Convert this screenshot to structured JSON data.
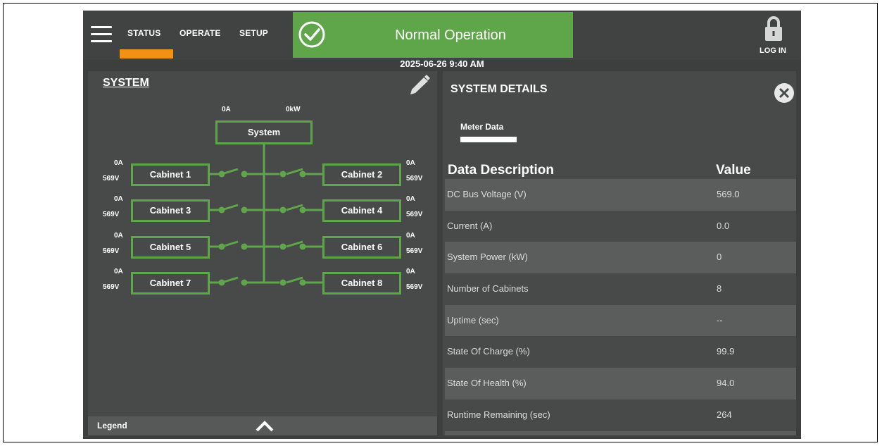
{
  "nav": {
    "items": [
      {
        "label": "STATUS",
        "active": true
      },
      {
        "label": "OPERATE",
        "active": false
      },
      {
        "label": "SETUP",
        "active": false
      }
    ]
  },
  "status": {
    "text": "Normal Operation",
    "color": "#5fa64a",
    "icon": "check-circle-icon"
  },
  "login": {
    "label": "LOG IN",
    "icon": "lock-icon"
  },
  "timestamp": "2025-06-26 9:40 AM",
  "system_panel": {
    "title": "SYSTEM",
    "edit_icon": "pencil-icon",
    "system_node": {
      "label": "System",
      "current": "0A",
      "power": "0kW"
    },
    "cabinets": [
      {
        "label": "Cabinet 1",
        "current": "0A",
        "voltage": "569V"
      },
      {
        "label": "Cabinet 2",
        "current": "0A",
        "voltage": "569V"
      },
      {
        "label": "Cabinet 3",
        "current": "0A",
        "voltage": "569V"
      },
      {
        "label": "Cabinet 4",
        "current": "0A",
        "voltage": "569V"
      },
      {
        "label": "Cabinet 5",
        "current": "0A",
        "voltage": "569V"
      },
      {
        "label": "Cabinet 6",
        "current": "0A",
        "voltage": "569V"
      },
      {
        "label": "Cabinet 7",
        "current": "0A",
        "voltage": "569V"
      },
      {
        "label": "Cabinet 8",
        "current": "0A",
        "voltage": "569V"
      }
    ],
    "legend_label": "Legend"
  },
  "details": {
    "title": "SYSTEM DETAILS",
    "tab": "Meter Data",
    "header_desc": "Data Description",
    "header_value": "Value",
    "rows": [
      {
        "desc": "DC Bus Voltage (V)",
        "value": "569.0"
      },
      {
        "desc": "Current (A)",
        "value": "0.0"
      },
      {
        "desc": "System Power (kW)",
        "value": "0"
      },
      {
        "desc": "Number of Cabinets",
        "value": "8"
      },
      {
        "desc": "Uptime (sec)",
        "value": "--"
      },
      {
        "desc": "State Of Charge (%)",
        "value": "99.9"
      },
      {
        "desc": "State Of Health (%)",
        "value": "94.0"
      },
      {
        "desc": "Runtime Remaining (sec)",
        "value": "264"
      }
    ]
  },
  "colors": {
    "accent": "#f39016",
    "green": "#5fa64a",
    "background": "#3d3e3e"
  }
}
